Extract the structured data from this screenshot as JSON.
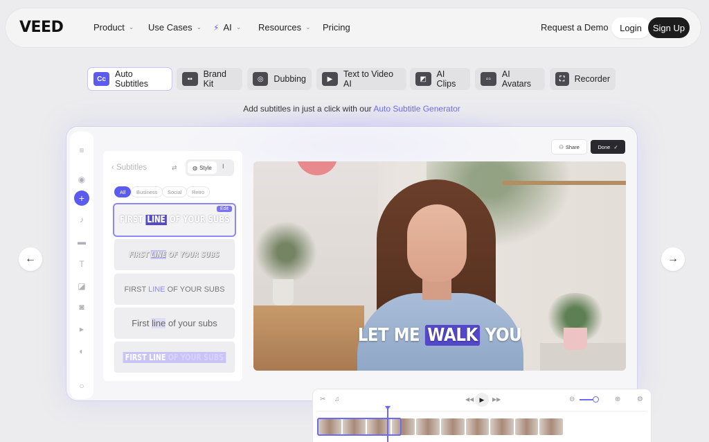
{
  "nav": {
    "logo": "VEED",
    "items": [
      {
        "label": "Product",
        "dropdown": true
      },
      {
        "label": "Use Cases",
        "dropdown": true
      },
      {
        "label": "AI",
        "dropdown": true
      },
      {
        "label": "Resources",
        "dropdown": true
      },
      {
        "label": "Pricing",
        "dropdown": false
      }
    ],
    "demo_label": "Request a Demo",
    "login_label": "Login",
    "signup_label": "Sign Up"
  },
  "features": [
    {
      "label": "Auto Subtitles",
      "icon": "Cc",
      "active": true
    },
    {
      "label": "Brand Kit",
      "icon": "brand-kit-icon"
    },
    {
      "label": "Dubbing",
      "icon": "dubbing-icon"
    },
    {
      "label": "Text to Video AI",
      "icon": "text-to-video-icon"
    },
    {
      "label": "AI Clips",
      "icon": "clips-icon"
    },
    {
      "label": "AI Avatars",
      "icon": "avatar-icon"
    },
    {
      "label": "Recorder",
      "icon": "recorder-icon"
    }
  ],
  "tagline": {
    "prefix": "Add subtitles in just a click with our",
    "link": "Auto Subtitle Generator"
  },
  "panel": {
    "title": "Subtitles",
    "style_label": "Style",
    "filters": [
      "All",
      "Business",
      "Social",
      "Retro"
    ],
    "edit_label": "Edit",
    "styles": [
      {
        "a": "FIRST",
        "b": "LINE",
        "c": "OF YOUR SUBS"
      },
      {
        "a": "FIRST",
        "b": "LINE",
        "c": "OF YOUR SUBS"
      },
      {
        "a": "FIRST",
        "b": "LINE",
        "c": "OF YOUR SUBS"
      },
      {
        "a": "First",
        "b": "line",
        "c": "of your subs"
      },
      {
        "a": "FIRST",
        "b": "LINE",
        "c": "OF YOUR SUBS"
      }
    ]
  },
  "video": {
    "caption_a": "LET ME",
    "caption_b": "WALK",
    "caption_c": "YOU"
  },
  "actions": {
    "share_label": "Share",
    "done_label": "Done"
  },
  "colors": {
    "accent": "#5b5bf0",
    "dark": "#1c1c1c"
  }
}
